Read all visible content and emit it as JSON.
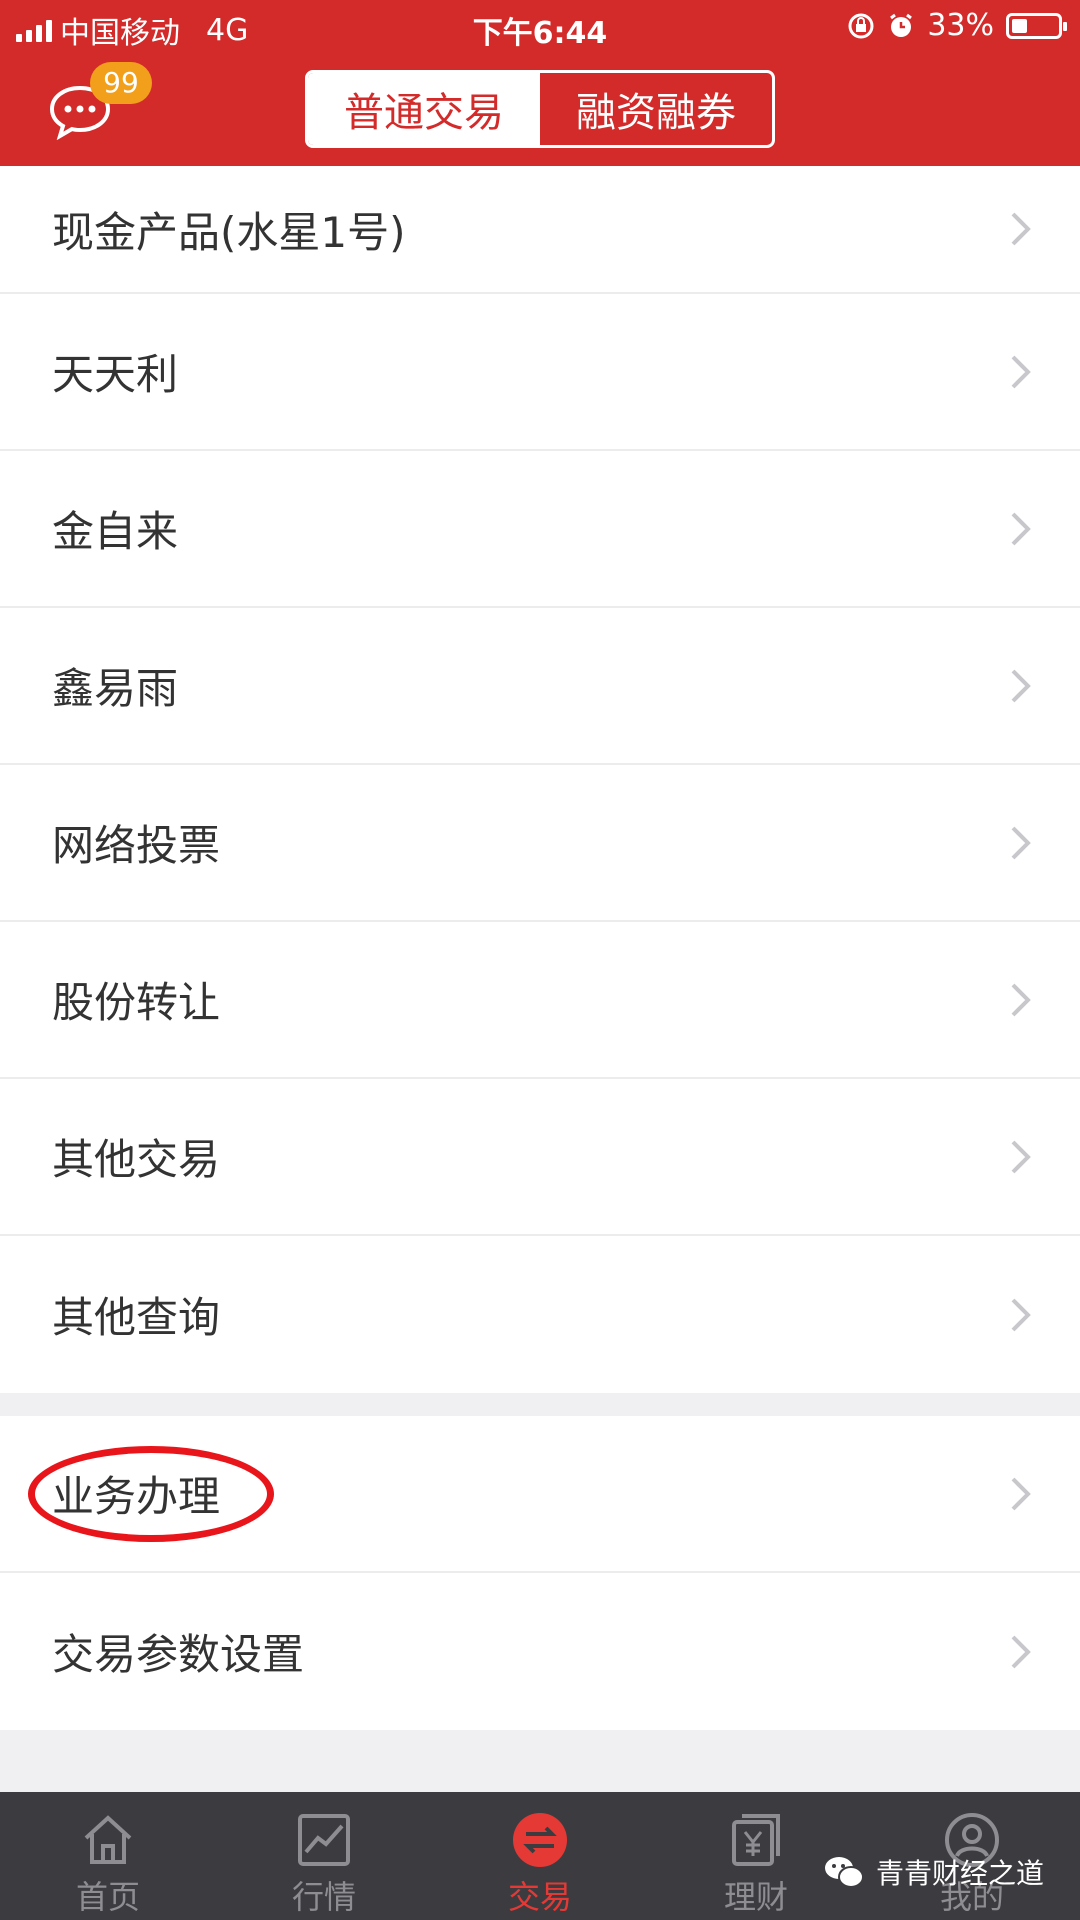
{
  "status_bar": {
    "carrier": "中国移动",
    "network": "4G",
    "time": "下午6:44",
    "battery": "33%",
    "battery_level": 0.33
  },
  "header": {
    "badge_count": "99",
    "segment_tabs": [
      {
        "label": "普通交易",
        "active": true
      },
      {
        "label": "融资融券",
        "active": false
      }
    ]
  },
  "menu_items": [
    "现金产品(水星1号)",
    "天天利",
    "金自来",
    "鑫易雨",
    "网络投票",
    "股份转让",
    "其他交易",
    "其他查询"
  ],
  "service_items": [
    "业务办理",
    "交易参数设置"
  ],
  "tabbar": [
    {
      "label": "首页",
      "icon": "home-icon"
    },
    {
      "label": "行情",
      "icon": "chart-icon"
    },
    {
      "label": "交易",
      "icon": "exchange-icon",
      "active": true
    },
    {
      "label": "理财",
      "icon": "finance-icon"
    },
    {
      "label": "我的",
      "icon": "profile-icon"
    }
  ],
  "watermark": "青青财经之道",
  "colors": {
    "brand_red": "#d32a2a",
    "badge_orange": "#f29f1b",
    "highlight_red": "#e8151b",
    "tabbar_bg": "#3c3c40"
  }
}
